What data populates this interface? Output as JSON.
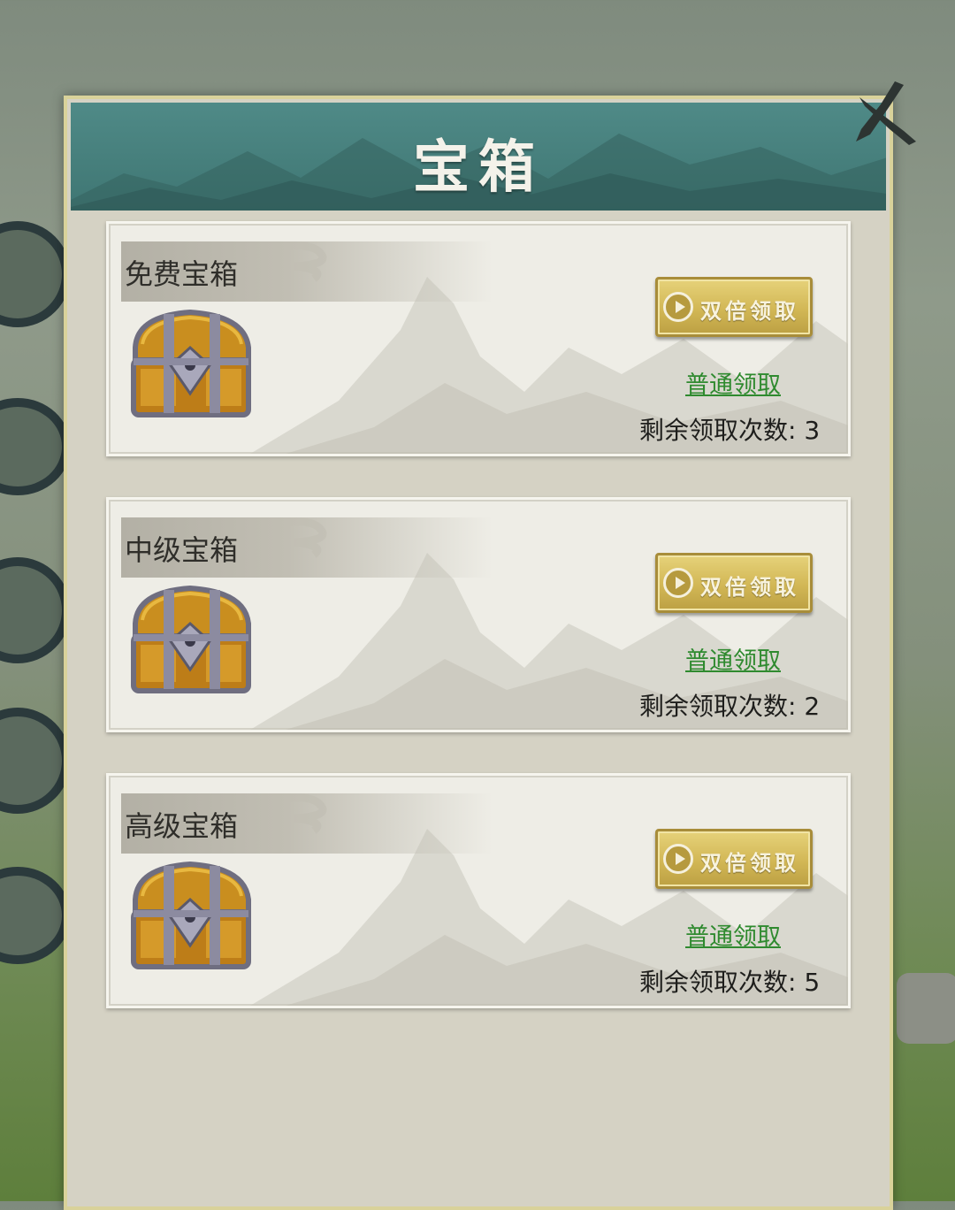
{
  "dialog": {
    "title": "宝箱",
    "close_icon": "close-x-icon"
  },
  "cards": [
    {
      "title": "免费宝箱",
      "chest_icon": "treasure-chest-icon",
      "double_button_label": "双倍领取",
      "double_button_icon": "play-video-icon",
      "normal_claim_label": "普通领取",
      "remaining_text": "剩余领取次数: 3"
    },
    {
      "title": "中级宝箱",
      "chest_icon": "treasure-chest-icon",
      "double_button_label": "双倍领取",
      "double_button_icon": "play-video-icon",
      "normal_claim_label": "普通领取",
      "remaining_text": "剩余领取次数: 2"
    },
    {
      "title": "高级宝箱",
      "chest_icon": "treasure-chest-icon",
      "double_button_label": "双倍领取",
      "double_button_icon": "play-video-icon",
      "normal_claim_label": "普通领取",
      "remaining_text": "剩余领取次数: 5"
    }
  ],
  "colors": {
    "header": "#3f7673",
    "button_gold": "#d2b755",
    "link_green": "#2f8a2f"
  }
}
